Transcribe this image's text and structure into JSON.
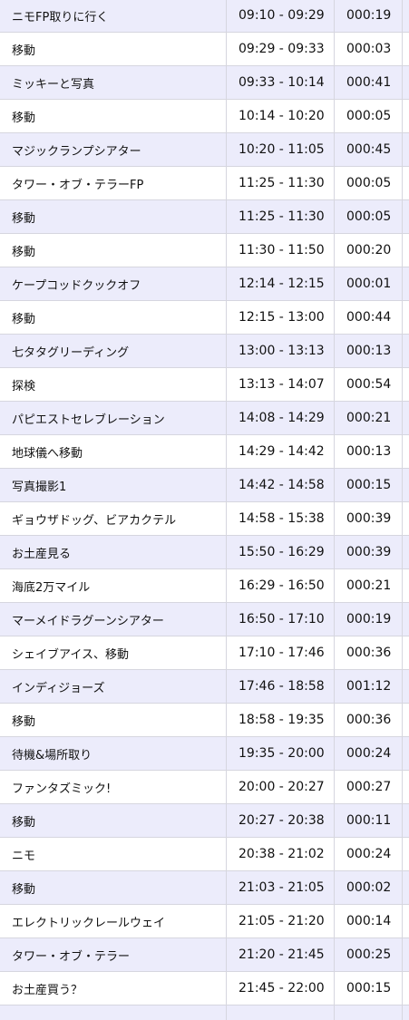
{
  "schedule": {
    "rows": [
      {
        "activity": "ニモFP取りに行く",
        "time_range": "09:10 - 09:29",
        "duration": "000:19"
      },
      {
        "activity": "移動",
        "time_range": "09:29 - 09:33",
        "duration": "000:03"
      },
      {
        "activity": "ミッキーと写真",
        "time_range": "09:33 - 10:14",
        "duration": "000:41"
      },
      {
        "activity": "移動",
        "time_range": "10:14 - 10:20",
        "duration": "000:05"
      },
      {
        "activity": "マジックランプシアター",
        "time_range": "10:20 - 11:05",
        "duration": "000:45"
      },
      {
        "activity": "タワー・オブ・テラーFP",
        "time_range": "11:25 - 11:30",
        "duration": "000:05"
      },
      {
        "activity": "移動",
        "time_range": "11:25 - 11:30",
        "duration": "000:05"
      },
      {
        "activity": "移動",
        "time_range": "11:30 - 11:50",
        "duration": "000:20"
      },
      {
        "activity": "ケープコッドクックオフ",
        "time_range": "12:14 - 12:15",
        "duration": "000:01"
      },
      {
        "activity": "移動",
        "time_range": "12:15 - 13:00",
        "duration": "000:44"
      },
      {
        "activity": "七タタグリーディング",
        "time_range": "13:00 - 13:13",
        "duration": "000:13"
      },
      {
        "activity": "探検",
        "time_range": "13:13 - 14:07",
        "duration": "000:54"
      },
      {
        "activity": "パピエストセレブレーション",
        "time_range": "14:08 - 14:29",
        "duration": "000:21"
      },
      {
        "activity": "地球儀へ移動",
        "time_range": "14:29 - 14:42",
        "duration": "000:13"
      },
      {
        "activity": "写真撮影1",
        "time_range": "14:42 - 14:58",
        "duration": "000:15"
      },
      {
        "activity": "ギョウザドッグ、ビアカクテル",
        "time_range": "14:58 - 15:38",
        "duration": "000:39"
      },
      {
        "activity": "お土産見る",
        "time_range": "15:50 - 16:29",
        "duration": "000:39"
      },
      {
        "activity": "海底2万マイル",
        "time_range": "16:29 - 16:50",
        "duration": "000:21"
      },
      {
        "activity": "マーメイドラグーンシアター",
        "time_range": "16:50 - 17:10",
        "duration": "000:19"
      },
      {
        "activity": "シェイブアイス、移動",
        "time_range": "17:10 - 17:46",
        "duration": "000:36"
      },
      {
        "activity": "インディジョーズ",
        "time_range": "17:46 - 18:58",
        "duration": "001:12"
      },
      {
        "activity": "移動",
        "time_range": "18:58 - 19:35",
        "duration": "000:36"
      },
      {
        "activity": "待機&場所取り",
        "time_range": "19:35 - 20:00",
        "duration": "000:24"
      },
      {
        "activity": "ファンタズミック!",
        "time_range": "20:00 - 20:27",
        "duration": "000:27"
      },
      {
        "activity": "移動",
        "time_range": "20:27 - 20:38",
        "duration": "000:11"
      },
      {
        "activity": "ニモ",
        "time_range": "20:38 - 21:02",
        "duration": "000:24"
      },
      {
        "activity": "移動",
        "time_range": "21:03 - 21:05",
        "duration": "000:02"
      },
      {
        "activity": "エレクトリックレールウェイ",
        "time_range": "21:05 - 21:20",
        "duration": "000:14"
      },
      {
        "activity": "タワー・オブ・テラー",
        "time_range": "21:20 - 21:45",
        "duration": "000:25"
      },
      {
        "activity": "お土産買う？",
        "time_range": "21:45 - 22:00",
        "duration": "000:15"
      },
      {
        "activity": "",
        "time_range": "",
        "duration": ""
      }
    ]
  }
}
